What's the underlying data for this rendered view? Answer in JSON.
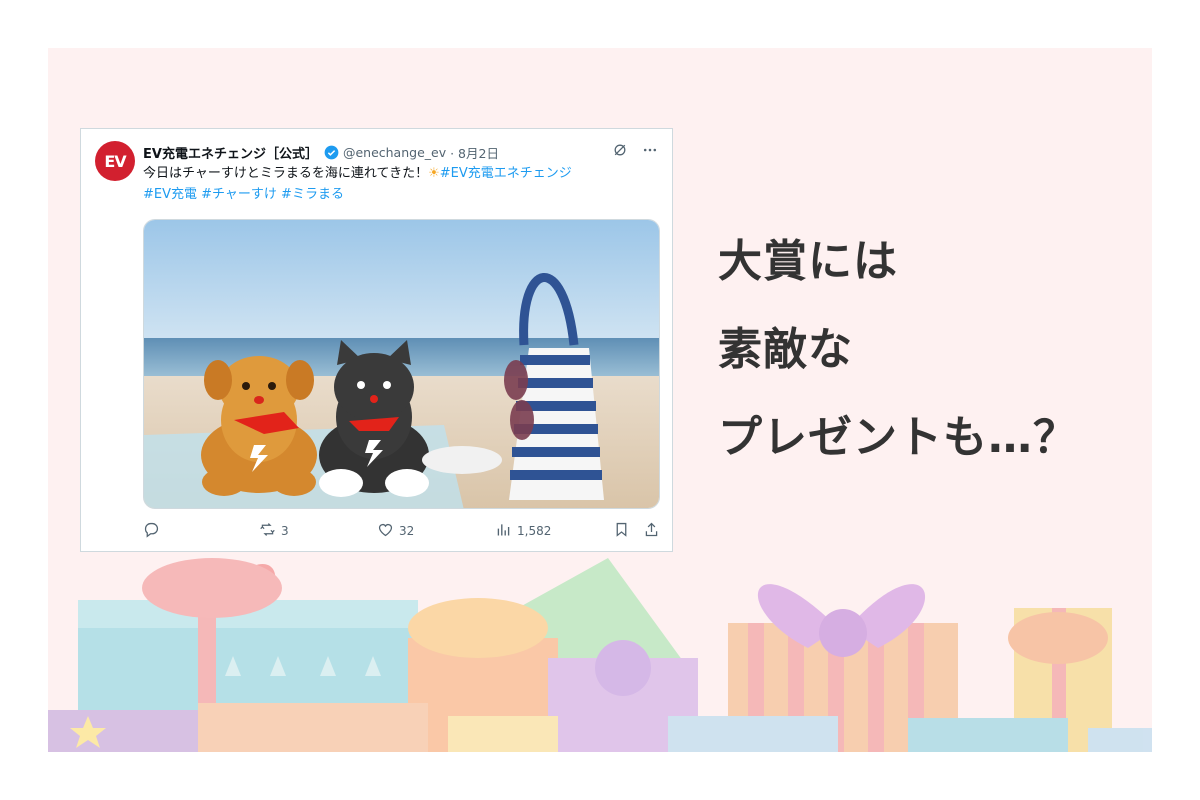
{
  "tweet": {
    "avatar_text": "EV",
    "display_name": "EV充電エネチェンジ［公式］",
    "handle": "@enechange_ev",
    "date": "· 8月2日",
    "text_main": "今日はチャーすけとミラまるを海に連れてきた！",
    "sun_emoji": "☀",
    "hashtags": [
      "#EV充電エネチェンジ",
      "#EV充電",
      "#チャーすけ",
      "#ミラまる"
    ],
    "stats": {
      "replies": "",
      "retweets": "3",
      "likes": "32",
      "views": "1,582"
    }
  },
  "headline": {
    "line1": "大賞には",
    "line2": "素敵な",
    "line3": "プレゼントも…？"
  },
  "colors": {
    "background": "#fef1f1",
    "accent_blue": "#1d9bf0",
    "brand_red": "#d2202f",
    "text_dark": "#333333"
  }
}
